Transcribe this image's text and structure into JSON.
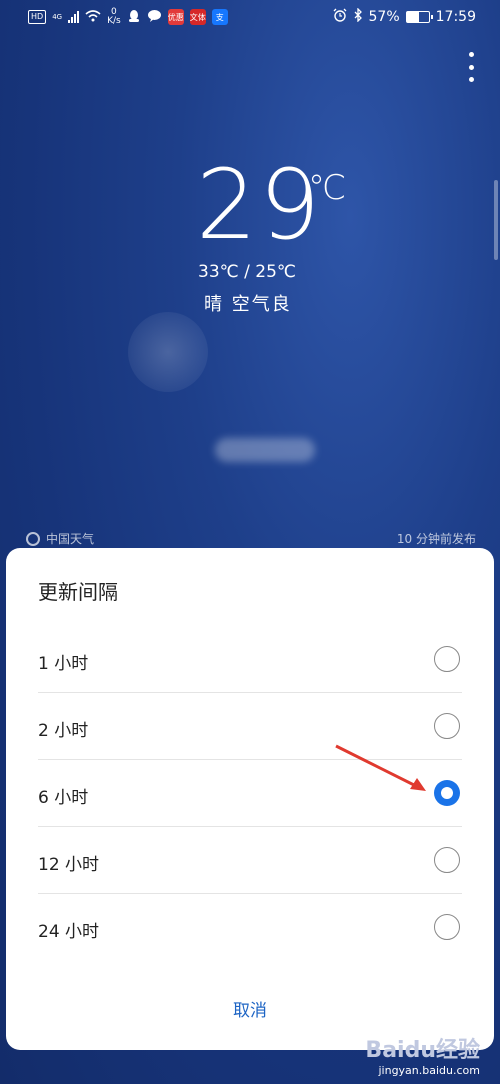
{
  "status": {
    "hd": "HD",
    "network_gen": "4G",
    "net_speed_value": "0",
    "net_speed_unit": "K/s",
    "battery_percent": "57%",
    "battery_level": 0.57,
    "time": "17:59",
    "app_icons": [
      {
        "name": "qq-icon",
        "color": "#ffffff"
      },
      {
        "name": "chat-bubble-icon",
        "color": "#ffffff"
      },
      {
        "name": "app-red-icon",
        "label": "优惠",
        "color": "#e23a3a"
      },
      {
        "name": "app-wenyu-icon",
        "label": "文体",
        "color": "#d62828"
      },
      {
        "name": "alipay-icon",
        "label": "支",
        "color": "#1677ff"
      }
    ]
  },
  "weather": {
    "temperature": "29",
    "unit": "℃",
    "range": "33℃ / 25℃",
    "condition": "晴  空气良",
    "source": "中国天气",
    "published": "10 分钟前发布"
  },
  "dialog": {
    "title": "更新间隔",
    "options": [
      {
        "label": "1 小时",
        "selected": false
      },
      {
        "label": "2 小时",
        "selected": false
      },
      {
        "label": "6 小时",
        "selected": true
      },
      {
        "label": "12 小时",
        "selected": false
      },
      {
        "label": "24 小时",
        "selected": false
      }
    ],
    "cancel_label": "取消"
  },
  "annotation": {
    "arrow_color": "#e03a2f"
  },
  "watermark": {
    "logo": "Baidu经验",
    "url": "jingyan.baidu.com"
  }
}
